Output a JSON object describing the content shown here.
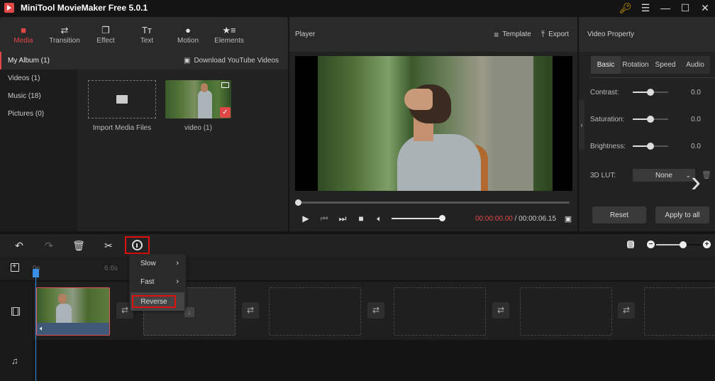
{
  "app": {
    "title": "MiniTool MovieMaker Free 5.0.1",
    "window_controls": [
      "key-icon",
      "menu-icon",
      "minimize-icon",
      "maximize-icon",
      "close-icon"
    ]
  },
  "media_toolbar": {
    "tabs": [
      {
        "label": "Media",
        "icon": "folder-icon",
        "active": true
      },
      {
        "label": "Transition",
        "icon": "swap-arrows-icon",
        "active": false
      },
      {
        "label": "Effect",
        "icon": "layers-icon",
        "active": false
      },
      {
        "label": "Text",
        "icon": "text-icon",
        "active": false
      },
      {
        "label": "Motion",
        "icon": "motion-sphere-icon",
        "active": false
      },
      {
        "label": "Elements",
        "icon": "star-list-icon",
        "active": false
      }
    ]
  },
  "album": {
    "sidebar": [
      {
        "label": "My Album (1)",
        "active": true
      },
      {
        "label": "Videos (1)",
        "active": false
      },
      {
        "label": "Music (18)",
        "active": false
      },
      {
        "label": "Pictures (0)",
        "active": false
      }
    ],
    "download_label": "Download YouTube Videos",
    "import_label": "Import Media Files",
    "items": [
      {
        "label": "video (1)",
        "selected": true
      }
    ]
  },
  "player": {
    "title": "Player",
    "template_label": "Template",
    "export_label": "Export",
    "current_time": "00:00:00.00",
    "separator": " / ",
    "total_time": "00:00:06.15",
    "progress": 0,
    "volume": 1.0
  },
  "property": {
    "title": "Video Property",
    "tabs": [
      "Basic",
      "Rotation",
      "Speed",
      "Audio"
    ],
    "active_tab": "Basic",
    "sliders": [
      {
        "label": "Contrast:",
        "value": "0.0",
        "position": 0.5
      },
      {
        "label": "Saturation:",
        "value": "0.0",
        "position": 0.5
      },
      {
        "label": "Brightness:",
        "value": "0.0",
        "position": 0.5
      }
    ],
    "lut_label": "3D LUT:",
    "lut_value": "None",
    "reset_label": "Reset",
    "apply_all_label": "Apply to all"
  },
  "timeline": {
    "zoom_level": 0.6,
    "ruler_ticks": [
      "0s",
      "6.6s"
    ],
    "speed_menu": [
      {
        "label": "Slow",
        "submenu": true
      },
      {
        "label": "Fast",
        "submenu": true
      },
      {
        "label": "Reverse",
        "submenu": false,
        "highlighted": true
      }
    ]
  },
  "colors": {
    "accent": "#e04848",
    "highlight_box": "#e01010",
    "playhead": "#3a8ee6"
  }
}
